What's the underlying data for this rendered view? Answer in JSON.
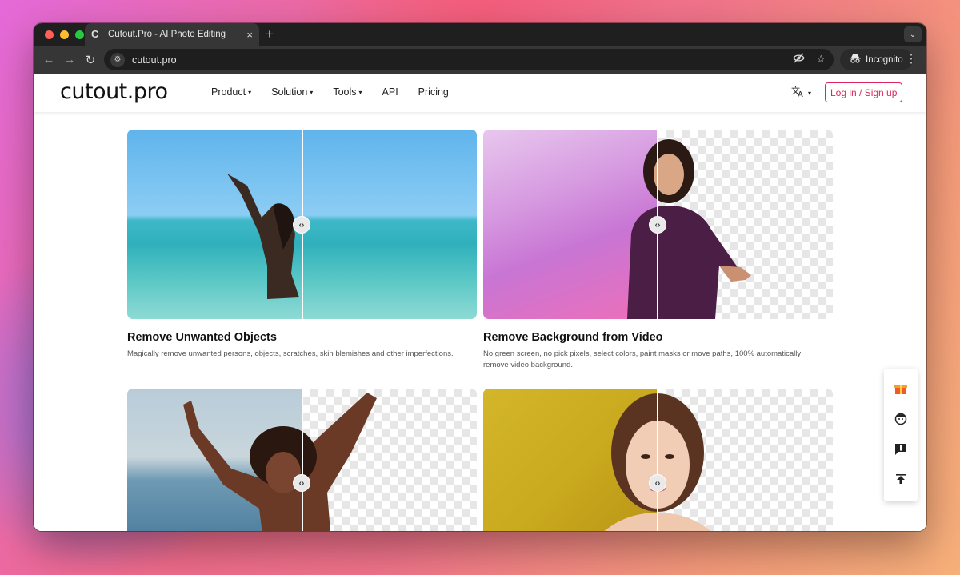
{
  "browser": {
    "tab_title": "Cutout.Pro - AI Photo Editing",
    "tab_favicon": "C",
    "tab_close": "×",
    "new_tab": "+",
    "url": "cutout.pro",
    "incognito_label": "Incognito"
  },
  "site": {
    "logo": "cutout.pro",
    "nav": [
      {
        "label": "Product",
        "has_dropdown": true
      },
      {
        "label": "Solution",
        "has_dropdown": true
      },
      {
        "label": "Tools",
        "has_dropdown": true
      },
      {
        "label": "API",
        "has_dropdown": false
      },
      {
        "label": "Pricing",
        "has_dropdown": false
      }
    ],
    "login_label": "Log in / Sign up",
    "accent_color": "#e0245e"
  },
  "features": [
    {
      "title": "Remove Unwanted Objects",
      "description": "Magically remove unwanted persons, objects, scratches, skin blemishes and other imperfections."
    },
    {
      "title": "Remove Background from Video",
      "description": "No green screen, no pick pixels, select colors, paint masks or move paths, 100% automatically remove video background."
    }
  ],
  "side_panel": {
    "icons": [
      "gift-icon",
      "avatar-face-icon",
      "feedback-icon",
      "back-to-top-icon"
    ]
  }
}
